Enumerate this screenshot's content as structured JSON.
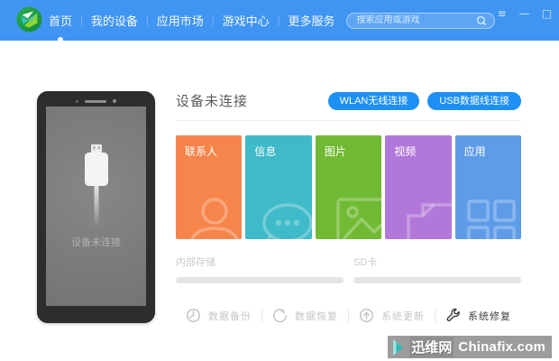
{
  "window": {
    "controls": {
      "menu": "≡",
      "minimize": "—",
      "maximize": "□",
      "close": "✕"
    }
  },
  "nav": {
    "items": [
      {
        "label": "首页",
        "active": true
      },
      {
        "label": "我的设备",
        "active": false
      },
      {
        "label": "应用市场",
        "active": false
      },
      {
        "label": "游戏中心",
        "active": false
      },
      {
        "label": "更多服务",
        "active": false
      }
    ]
  },
  "search": {
    "placeholder": "搜索应用或游戏",
    "value": ""
  },
  "device_panel": {
    "screen_label": "设备未连接"
  },
  "main": {
    "title": "设备未连接",
    "connect_buttons": [
      {
        "label": "WLAN无线连接"
      },
      {
        "label": "USB数据线连接"
      }
    ],
    "tiles": [
      {
        "label": "联系人",
        "color": "#f6854c",
        "icon": "contacts-icon"
      },
      {
        "label": "信息",
        "color": "#3fbac8",
        "icon": "messages-icon"
      },
      {
        "label": "图片",
        "color": "#71ba33",
        "icon": "pictures-icon"
      },
      {
        "label": "视频",
        "color": "#b278d9",
        "icon": "videos-icon"
      },
      {
        "label": "应用",
        "color": "#5f9ce8",
        "icon": "apps-icon"
      }
    ],
    "storage": [
      {
        "label": "内部存储"
      },
      {
        "label": "SD卡"
      }
    ],
    "actions": [
      {
        "label": "数据备份",
        "enabled": false,
        "icon": "backup-icon"
      },
      {
        "label": "数据恢复",
        "enabled": false,
        "icon": "restore-icon"
      },
      {
        "label": "系统更新",
        "enabled": false,
        "icon": "update-icon"
      },
      {
        "label": "系统修复",
        "enabled": true,
        "icon": "repair-icon"
      }
    ]
  },
  "watermark": {
    "site_name": "迅维网",
    "site_domain": "Chinafix.com"
  },
  "colors": {
    "header": "#4095f2",
    "accent_button": "#1d90f5",
    "phone_body": "#2d2d2d",
    "phone_screen": "#7d7d7d",
    "watermark_bg": "#9c9c9c",
    "watermark_teal": "#2fb9b6"
  }
}
